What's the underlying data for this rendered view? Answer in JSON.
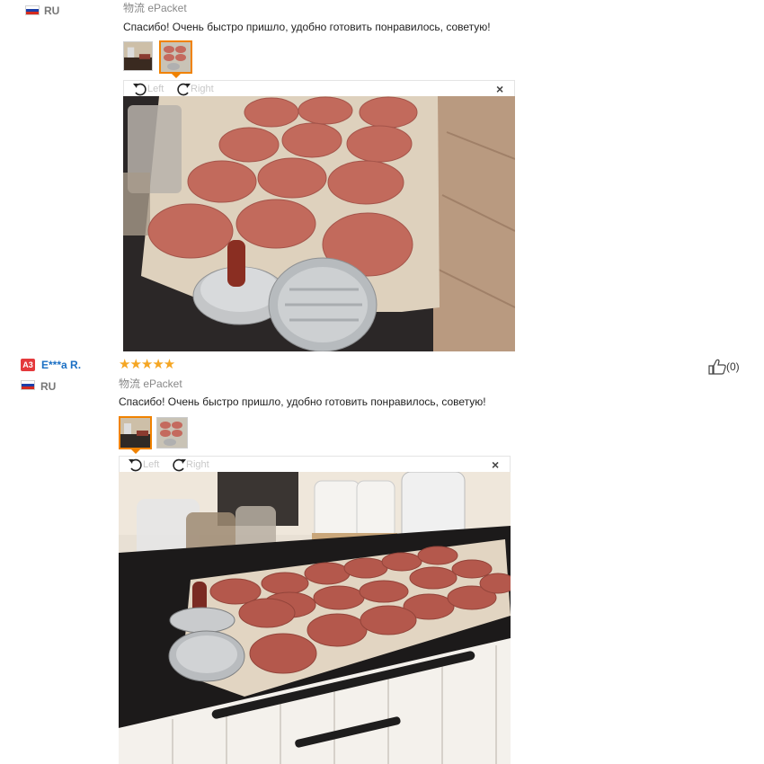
{
  "review1": {
    "country": "RU",
    "shipping": "物流 ePacket",
    "text": "Спасибо! Очень быстро пришло, удобно готовить понравилось, советую!",
    "viewer": {
      "left_label": "Left",
      "right_label": "Right",
      "close_symbol": "×"
    }
  },
  "review2": {
    "badge": "A3",
    "user": "E***a R.",
    "stars": "★★★★★",
    "helpful_count": "(0)",
    "country": "RU",
    "shipping": "物流 ePacket",
    "text": "Спасибо! Очень быстро пришло, удобно готовить понравилось, советую!",
    "viewer": {
      "left_label": "Left",
      "right_label": "Right",
      "close_symbol": "×"
    }
  },
  "colors": {
    "link": "#1a6fc4",
    "star": "#f5a623",
    "active_thumb": "#f08200",
    "badge": "#e4393c"
  }
}
